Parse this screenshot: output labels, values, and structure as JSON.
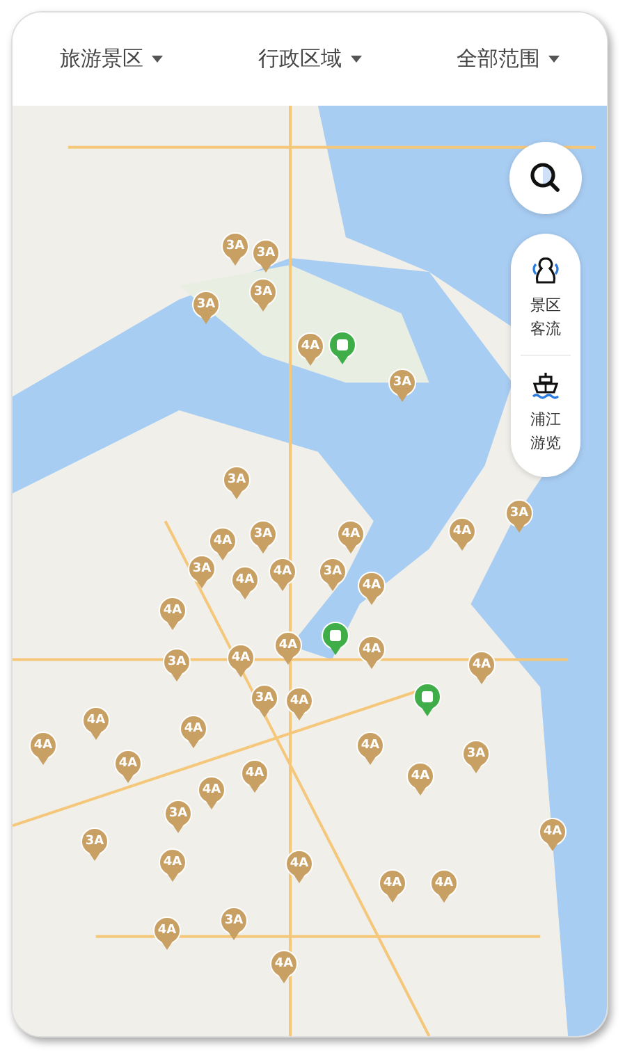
{
  "filters": [
    {
      "label": "旅游景区"
    },
    {
      "label": "行政区域"
    },
    {
      "label": "全部范围"
    }
  ],
  "side_panel": {
    "items": [
      {
        "kind": "people",
        "label": "景区客流"
      },
      {
        "kind": "boat",
        "label": "浦江游览"
      }
    ]
  },
  "map": {
    "pins": [
      {
        "label": "3A",
        "color": "#c9a063"
      },
      {
        "label": "3A",
        "color": "#c9a063"
      },
      {
        "label": "3A",
        "color": "#c9a063"
      },
      {
        "label": "3A",
        "color": "#c9a063"
      },
      {
        "label": "4A",
        "color": "#c9a063"
      },
      {
        "kind": "active",
        "color": "#3fae49"
      },
      {
        "label": "3A",
        "color": "#c9a063"
      },
      {
        "label": "3A",
        "color": "#c9a063"
      },
      {
        "label": "3A",
        "color": "#c9a063"
      },
      {
        "label": "4A",
        "color": "#c9a063"
      },
      {
        "label": "3A",
        "color": "#c9a063"
      },
      {
        "label": "4A",
        "color": "#c9a063"
      },
      {
        "label": "4A",
        "color": "#c9a063"
      },
      {
        "label": "3A",
        "color": "#c9a063"
      },
      {
        "label": "4A",
        "color": "#c9a063"
      },
      {
        "label": "4A",
        "color": "#c9a063"
      },
      {
        "label": "3A",
        "color": "#c9a063"
      },
      {
        "label": "4A",
        "color": "#c9a063"
      },
      {
        "label": "4A",
        "color": "#c9a063"
      },
      {
        "kind": "active",
        "color": "#3fae49"
      },
      {
        "label": "4A",
        "color": "#c9a063"
      },
      {
        "label": "4A",
        "color": "#c9a063"
      },
      {
        "label": "3A",
        "color": "#c9a063"
      },
      {
        "label": "4A",
        "color": "#c9a063"
      },
      {
        "label": "4A",
        "color": "#c9a063"
      },
      {
        "label": "3A",
        "color": "#c9a063"
      },
      {
        "label": "4A",
        "color": "#c9a063"
      },
      {
        "kind": "active",
        "color": "#3fae49"
      },
      {
        "label": "4A",
        "color": "#c9a063"
      },
      {
        "label": "4A",
        "color": "#c9a063"
      },
      {
        "label": "4A",
        "color": "#c9a063"
      },
      {
        "label": "4A",
        "color": "#c9a063"
      },
      {
        "label": "3A",
        "color": "#c9a063"
      },
      {
        "label": "4A",
        "color": "#c9a063"
      },
      {
        "label": "4A",
        "color": "#c9a063"
      },
      {
        "label": "4A",
        "color": "#c9a063"
      },
      {
        "label": "4A",
        "color": "#c9a063"
      },
      {
        "label": "3A",
        "color": "#c9a063"
      },
      {
        "label": "3A",
        "color": "#c9a063"
      },
      {
        "label": "4A",
        "color": "#c9a063"
      },
      {
        "label": "4A",
        "color": "#c9a063"
      },
      {
        "label": "4A",
        "color": "#c9a063"
      },
      {
        "label": "4A",
        "color": "#c9a063"
      },
      {
        "label": "4A",
        "color": "#c9a063"
      },
      {
        "label": "4A",
        "color": "#c9a063"
      },
      {
        "label": "3A",
        "color": "#c9a063"
      },
      {
        "label": "4A",
        "color": "#c9a063"
      }
    ]
  }
}
